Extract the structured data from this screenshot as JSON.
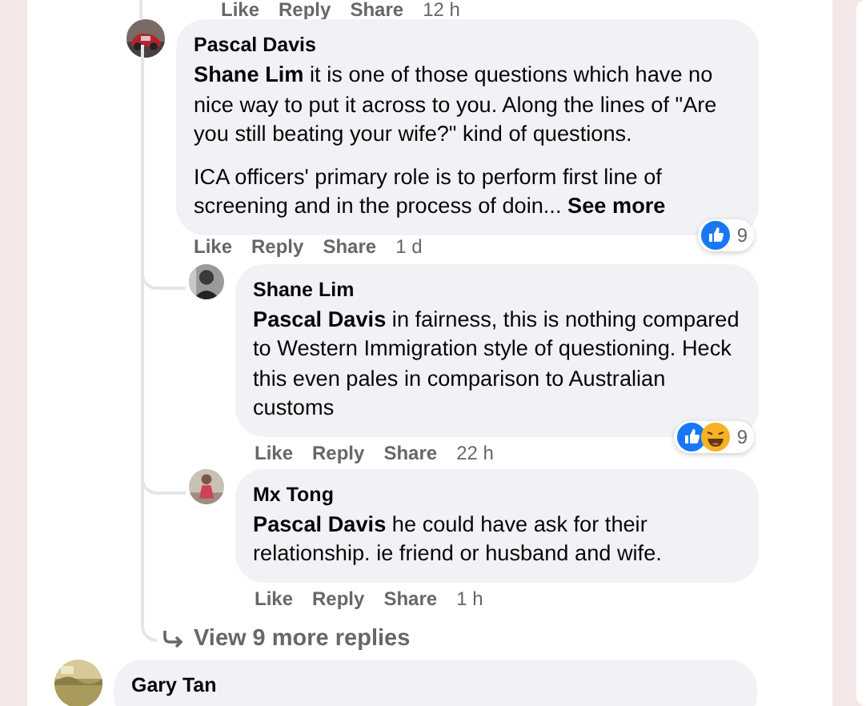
{
  "top_actions": {
    "like": "Like",
    "reply": "Reply",
    "share": "Share",
    "time": "12 h"
  },
  "thread": {
    "author": "Pascal Davis",
    "paragraphs": [
      "**Shane Lim** it is one of those questions which have no nice way to put it across to you. Along the lines of \"Are you still beating your wife?\" kind of questions.",
      "ICA officers' primary role is to perform first line of screening and in the process of doin..."
    ],
    "see_more": "See more",
    "reactions": {
      "like": true,
      "haha": false,
      "count": "9"
    },
    "actions": {
      "like": "Like",
      "reply": "Reply",
      "share": "Share",
      "time": "1 d"
    },
    "replies": [
      {
        "author": "Shane Lim",
        "paragraphs": [
          "**Pascal Davis** in fairness, this is nothing compared to Western Immigration style of questioning. Heck this even pales in comparison to Australian customs"
        ],
        "reactions": {
          "like": true,
          "haha": true,
          "count": "9"
        },
        "actions": {
          "like": "Like",
          "reply": "Reply",
          "share": "Share",
          "time": "22 h"
        }
      },
      {
        "author": "Mx Tong",
        "paragraphs": [
          "**Pascal Davis** he could have ask for their relationship. ie friend or husband and wife."
        ],
        "actions": {
          "like": "Like",
          "reply": "Reply",
          "share": "Share",
          "time": "1 h"
        }
      }
    ],
    "view_more": "View 9 more replies"
  },
  "next_comment": {
    "author": "Gary Tan"
  }
}
